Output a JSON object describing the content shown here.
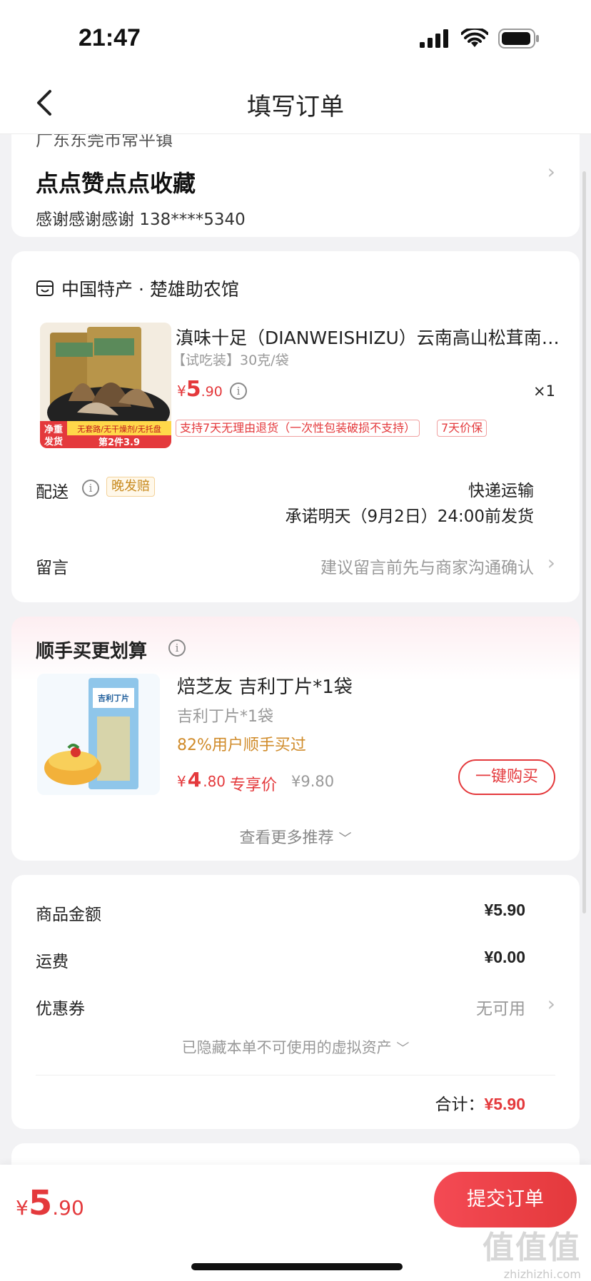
{
  "status_bar": {
    "time": "21:47"
  },
  "nav": {
    "title": "填写订单"
  },
  "address": {
    "partial_line": "广东东莞市常平镇",
    "name": "点点赞点点收藏",
    "contact": "感谢感谢感谢  138****5340"
  },
  "order": {
    "shop_name": "中国特产 · 楚雄助农馆",
    "product": {
      "title": "滇味十足（DIANWEISHIZU）云南高山松茸南华...",
      "spec": "【试吃装】30克/袋",
      "price_currency": "¥",
      "price_int": "5",
      "price_dec": ".90",
      "qty": "×1",
      "image_badge_left": "净重\n发货",
      "image_badge_top": "无套路/无干燥剂/无托盘",
      "image_badge_bottom": "第2件3.9",
      "tags": [
        "支持7天无理由退货（一次性包装破损不支持）",
        "7天价保"
      ]
    },
    "shipping": {
      "label": "配送",
      "late_tag": "晚发赔",
      "method": "快递运输",
      "promise": "承诺明天（9月2日）24:00前发货"
    },
    "message": {
      "label": "留言",
      "hint": "建议留言前先与商家沟通确认"
    }
  },
  "recommend": {
    "title": "顺手买更划算",
    "item": {
      "name": "焙芝友 吉利丁片*1袋",
      "sub": "吉利丁片*1袋",
      "percent": "82%用户顺手买过",
      "price_currency": "¥",
      "price_int": "4",
      "price_dec": ".80",
      "exclusive": "专享价",
      "original": "¥9.80",
      "buy_label": "一键购买",
      "image_text": "吉利丁片"
    },
    "more_label": "查看更多推荐"
  },
  "summary": {
    "rows": [
      {
        "label": "商品金额",
        "value": "¥5.90"
      },
      {
        "label": "运费",
        "value": "¥0.00"
      },
      {
        "label": "优惠券",
        "value": "无可用"
      }
    ],
    "hidden_assets": "已隐藏本单不可使用的虚拟资产",
    "total_label": "合计：",
    "total_value": "¥5.90"
  },
  "bottom": {
    "price_currency": "¥",
    "price_int": "5",
    "price_dec": ".90",
    "submit_label": "提交订单"
  },
  "watermark": {
    "big": "值值值",
    "small": "zhizhizhi.com"
  },
  "colors": {
    "accent": "#e4393c",
    "gold": "#d08b2a",
    "page_bg": "#f2f2f4"
  }
}
